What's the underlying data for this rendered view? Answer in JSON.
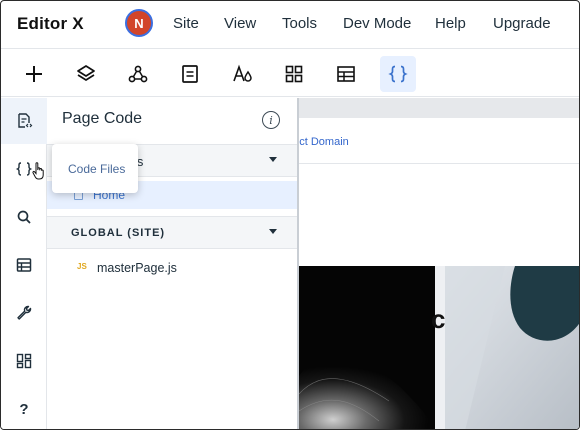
{
  "app": {
    "logo": "Editor X",
    "avatar_initial": "N",
    "avatar_color": "#d2452a"
  },
  "menu": {
    "items": [
      "Site",
      "View",
      "Tools",
      "Dev Mode",
      "Help",
      "Upgrade"
    ]
  },
  "toolbar": {
    "tools": [
      "add-icon",
      "layers-icon",
      "connect-icon",
      "pages-icon",
      "theme-icon",
      "grid-icon",
      "table-icon",
      "code-icon"
    ],
    "active": "code-icon"
  },
  "rail": {
    "items": [
      "page-code-icon",
      "code-files-icon",
      "search-icon",
      "database-icon",
      "tools-icon",
      "packages-icon",
      "help-icon"
    ],
    "help_glyph": "?"
  },
  "panel": {
    "title": "Page Code",
    "pages_section": "Pages",
    "pages_section_visible": "ts",
    "page_item": "Home",
    "global_section": "GLOBAL (SITE)",
    "file_badge": "JS",
    "file_item": "masterPage.js"
  },
  "tooltip": {
    "label": "Code Files"
  },
  "canvas": {
    "connect_domain": "nect Domain",
    "big_letter": "c"
  },
  "colors": {
    "accent": "#3a72cc",
    "active_bg": "#e7f0ff",
    "js_badge": "#e0a820"
  }
}
